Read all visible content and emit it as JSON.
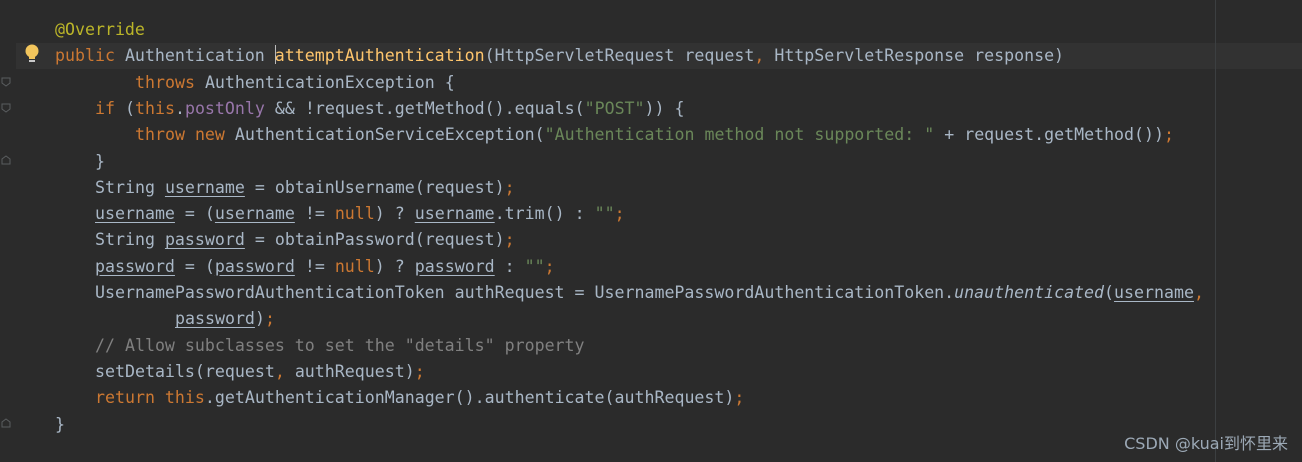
{
  "colors": {
    "background": "#2b2b2b",
    "default_text": "#a9b7c6",
    "keyword": "#cc7832",
    "annotation": "#bbb529",
    "string": "#6a8759",
    "field": "#9876aa",
    "method_declaration": "#ffc66d",
    "comment": "#808080"
  },
  "gutter": {
    "intention_icon": "lightbulb-icon",
    "fold_icon": "fold-marker-icon"
  },
  "code": [
    {
      "indent": 0,
      "tokens": [
        {
          "t": "@Override",
          "c": "ann"
        }
      ]
    },
    {
      "indent": 0,
      "tokens": [
        {
          "t": "public ",
          "c": "kw"
        },
        {
          "t": "Authentication "
        },
        {
          "t": "|caret|",
          "c": "caret"
        },
        {
          "t": "attemptAuthentication",
          "c": "fn"
        },
        {
          "t": "(HttpServletRequest request"
        },
        {
          "t": ", ",
          "c": "punct"
        },
        {
          "t": "HttpServletResponse response)"
        }
      ]
    },
    {
      "indent": 8,
      "tokens": [
        {
          "t": "throws ",
          "c": "kw"
        },
        {
          "t": "AuthenticationException {"
        }
      ]
    },
    {
      "indent": 4,
      "tokens": [
        {
          "t": "if ",
          "c": "kw"
        },
        {
          "t": "("
        },
        {
          "t": "this",
          "c": "kw"
        },
        {
          "t": "."
        },
        {
          "t": "postOnly",
          "c": "field"
        },
        {
          "t": " && !request.getMethod().equals("
        },
        {
          "t": "\"POST\"",
          "c": "str"
        },
        {
          "t": ")) {"
        }
      ]
    },
    {
      "indent": 8,
      "tokens": [
        {
          "t": "throw new ",
          "c": "kw"
        },
        {
          "t": "AuthenticationServiceException("
        },
        {
          "t": "\"Authentication method not supported: \"",
          "c": "str"
        },
        {
          "t": " + request.getMethod())"
        },
        {
          "t": ";",
          "c": "punct"
        }
      ]
    },
    {
      "indent": 4,
      "tokens": [
        {
          "t": "}"
        }
      ]
    },
    {
      "indent": 4,
      "tokens": [
        {
          "t": "String "
        },
        {
          "t": "username",
          "c": "ul"
        },
        {
          "t": " = obtainUsername(request)"
        },
        {
          "t": ";",
          "c": "punct"
        }
      ]
    },
    {
      "indent": 4,
      "tokens": [
        {
          "t": "username",
          "c": "ul"
        },
        {
          "t": " = ("
        },
        {
          "t": "username",
          "c": "ul"
        },
        {
          "t": " != "
        },
        {
          "t": "null",
          "c": "kw"
        },
        {
          "t": ") ? "
        },
        {
          "t": "username",
          "c": "ul"
        },
        {
          "t": ".trim() : "
        },
        {
          "t": "\"\"",
          "c": "str"
        },
        {
          "t": ";",
          "c": "punct"
        }
      ]
    },
    {
      "indent": 4,
      "tokens": [
        {
          "t": "String "
        },
        {
          "t": "password",
          "c": "ul"
        },
        {
          "t": " = obtainPassword(request)"
        },
        {
          "t": ";",
          "c": "punct"
        }
      ]
    },
    {
      "indent": 4,
      "tokens": [
        {
          "t": "password",
          "c": "ul"
        },
        {
          "t": " = ("
        },
        {
          "t": "password",
          "c": "ul"
        },
        {
          "t": " != "
        },
        {
          "t": "null",
          "c": "kw"
        },
        {
          "t": ") ? "
        },
        {
          "t": "password",
          "c": "ul"
        },
        {
          "t": " : "
        },
        {
          "t": "\"\"",
          "c": "str"
        },
        {
          "t": ";",
          "c": "punct"
        }
      ]
    },
    {
      "indent": 4,
      "tokens": [
        {
          "t": "UsernamePasswordAuthenticationToken authRequest = UsernamePasswordAuthenticationToken."
        },
        {
          "t": "unauthenticated",
          "c": "it"
        },
        {
          "t": "("
        },
        {
          "t": "username",
          "c": "ul"
        },
        {
          "t": ",",
          "c": "punct"
        }
      ]
    },
    {
      "indent": 12,
      "tokens": [
        {
          "t": "password",
          "c": "ul"
        },
        {
          "t": ")"
        },
        {
          "t": ";",
          "c": "punct"
        }
      ]
    },
    {
      "indent": 4,
      "tokens": [
        {
          "t": "// Allow subclasses to set the \"details\" property",
          "c": "com"
        }
      ]
    },
    {
      "indent": 4,
      "tokens": [
        {
          "t": "setDetails(request"
        },
        {
          "t": ", ",
          "c": "punct"
        },
        {
          "t": "authRequest)"
        },
        {
          "t": ";",
          "c": "punct"
        }
      ]
    },
    {
      "indent": 4,
      "tokens": [
        {
          "t": "return this",
          "c": "kw"
        },
        {
          "t": ".getAuthenticationManager().authenticate(authRequest)"
        },
        {
          "t": ";",
          "c": "punct"
        }
      ]
    },
    {
      "indent": 0,
      "tokens": [
        {
          "t": "}"
        }
      ]
    }
  ],
  "watermark": "CSDN @kuai到怀里来"
}
